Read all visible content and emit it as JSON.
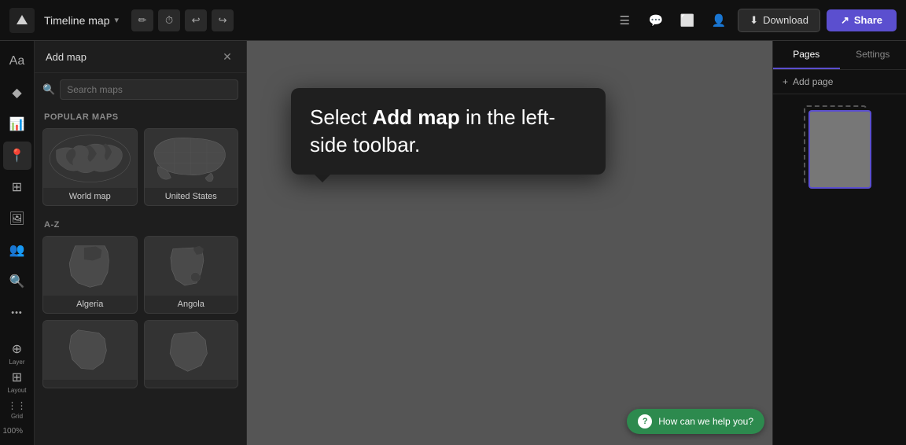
{
  "header": {
    "logo_icon": "◆",
    "title": "Timeline map",
    "chevron": "▾",
    "tool_icons": [
      "✏️",
      "⏱",
      "↩",
      "↪"
    ],
    "right_icons": [
      "☰",
      "💬",
      "⬜",
      "👤"
    ],
    "download_label": "Download",
    "download_icon": "⬇",
    "share_label": "Share",
    "share_icon": "↗"
  },
  "left_sidebar": {
    "items": [
      {
        "id": "text",
        "icon": "Aa",
        "label": ""
      },
      {
        "id": "elements",
        "icon": "◆",
        "label": ""
      },
      {
        "id": "chart",
        "icon": "📊",
        "label": ""
      },
      {
        "id": "map",
        "icon": "📍",
        "label": "",
        "active": true
      },
      {
        "id": "templates",
        "icon": "⊞",
        "label": ""
      },
      {
        "id": "photos",
        "icon": "🖼",
        "label": ""
      },
      {
        "id": "people",
        "icon": "👥",
        "label": ""
      },
      {
        "id": "more",
        "icon": "•••",
        "label": ""
      }
    ],
    "bottom_items": [
      {
        "id": "layer",
        "icon": "⊕",
        "label": "Layer"
      },
      {
        "id": "layout",
        "icon": "⊞",
        "label": "Layout"
      },
      {
        "id": "grid",
        "icon": "⋮⋮",
        "label": "Grid"
      }
    ],
    "zoom": "100%"
  },
  "panel": {
    "title": "Add map",
    "close_icon": "✕",
    "search_placeholder": "Search maps",
    "popular_section": "Popular maps",
    "az_section": "A-Z",
    "popular_maps": [
      {
        "label": "World map"
      },
      {
        "label": "United States"
      }
    ],
    "az_maps": [
      {
        "label": "Algeria"
      },
      {
        "label": "Angola"
      },
      {
        "label": ""
      },
      {
        "label": ""
      }
    ]
  },
  "tooltip": {
    "text_prefix": "Select ",
    "text_bold": "Add map",
    "text_suffix": " in the left-side toolbar."
  },
  "canvas": {
    "background": "#555555"
  },
  "right_sidebar": {
    "tabs": [
      {
        "label": "Pages",
        "active": true
      },
      {
        "label": "Settings",
        "active": false
      }
    ],
    "add_page_label": "Add page",
    "add_page_icon": "+"
  },
  "help": {
    "icon": "?",
    "label": "How can we help you?"
  },
  "colors": {
    "accent": "#5b4fcf",
    "bg_dark": "#111111",
    "bg_panel": "#1e1e1e",
    "help_green": "#2d8a4e"
  }
}
